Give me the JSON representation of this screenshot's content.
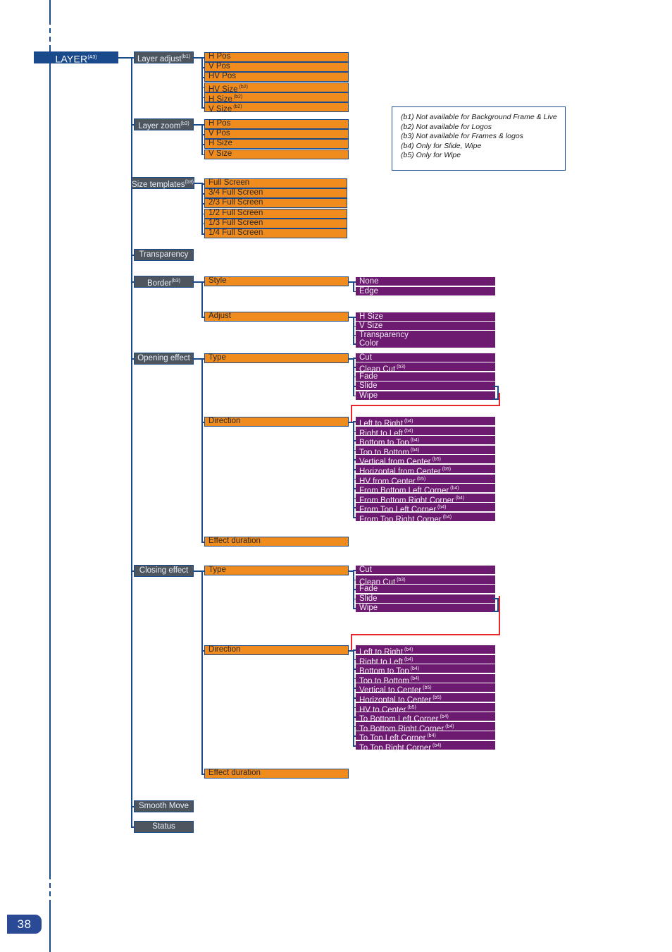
{
  "page": {
    "number": "38",
    "title": "LAYER",
    "title_sup": "(A3)"
  },
  "legend": {
    "lines": [
      "(b1) Not available for Background Frame & Live",
      "(b2) Not available for Logos",
      "(b3) Not available for Frames & logos",
      "(b4) Only for Slide, Wipe",
      "(b5) Only for Wipe"
    ]
  },
  "colors": {
    "navy": "#1b4a8c",
    "grey": "#4d565f",
    "orange": "#f08b1d",
    "purple": "#6d1a71",
    "red": "#e8272c",
    "page_tab": "#2a4a96"
  },
  "menu": {
    "layer_adjust": {
      "label": "Layer adjust",
      "sup": "(b1)"
    },
    "layer_adjust_items": [
      {
        "label": "H Pos",
        "sup": ""
      },
      {
        "label": "V Pos",
        "sup": ""
      },
      {
        "label": "HV Pos",
        "sup": ""
      },
      {
        "label": "HV Size",
        "sup": "(b2)"
      },
      {
        "label": "H Size",
        "sup": "(b2)"
      },
      {
        "label": "V Size",
        "sup": "(b2)"
      }
    ],
    "layer_zoom": {
      "label": "Layer zoom",
      "sup": "(b3)"
    },
    "layer_zoom_items": [
      {
        "label": "H Pos",
        "sup": ""
      },
      {
        "label": "V Pos",
        "sup": ""
      },
      {
        "label": "H Size",
        "sup": ""
      },
      {
        "label": "V Size",
        "sup": ""
      }
    ],
    "size_templates": {
      "label": "Size templates",
      "sup": "(b3)"
    },
    "size_templates_items": [
      {
        "label": "Full Screen",
        "sup": ""
      },
      {
        "label": "3/4 Full Screen",
        "sup": ""
      },
      {
        "label": "2/3 Full Screen",
        "sup": ""
      },
      {
        "label": "1/2 Full Screen",
        "sup": ""
      },
      {
        "label": "1/3 Full Screen",
        "sup": ""
      },
      {
        "label": "1/4 Full Screen",
        "sup": ""
      }
    ],
    "transparency": {
      "label": "Transparency",
      "sup": ""
    },
    "border": {
      "label": "Border",
      "sup": "(b3)"
    },
    "border_style": {
      "label": "Style",
      "sup": ""
    },
    "border_style_items": [
      {
        "label": "None",
        "sup": ""
      },
      {
        "label": "Edge",
        "sup": ""
      }
    ],
    "border_adjust": {
      "label": "Adjust",
      "sup": ""
    },
    "border_adjust_items": [
      {
        "label": "H Size",
        "sup": ""
      },
      {
        "label": "V Size",
        "sup": ""
      },
      {
        "label": "Transparency",
        "sup": ""
      },
      {
        "label": "Color",
        "sup": ""
      }
    ],
    "opening_effect": {
      "label": "Opening effect",
      "sup": ""
    },
    "opening_type": {
      "label": "Type",
      "sup": ""
    },
    "opening_type_items": [
      {
        "label": "Cut",
        "sup": ""
      },
      {
        "label": "Clean Cut",
        "sup": "(b3)"
      },
      {
        "label": "Fade",
        "sup": ""
      },
      {
        "label": "Slide",
        "sup": ""
      },
      {
        "label": "Wipe",
        "sup": ""
      }
    ],
    "opening_direction": {
      "label": "Direction",
      "sup": ""
    },
    "opening_direction_items": [
      {
        "label": "Left to Right",
        "sup": "(b4)"
      },
      {
        "label": "Right to Left",
        "sup": "(b4)"
      },
      {
        "label": "Bottom to Top",
        "sup": "(b4)"
      },
      {
        "label": "Top to Bottom",
        "sup": "(b4)"
      },
      {
        "label": "Vertical from Center",
        "sup": "(b5)"
      },
      {
        "label": "Horizontal from Center",
        "sup": "(b5)"
      },
      {
        "label": "HV from Center",
        "sup": "(b5)"
      },
      {
        "label": "From Bottom Left Corner",
        "sup": "(b4)"
      },
      {
        "label": "From Bottom Right Corner",
        "sup": "(b4)"
      },
      {
        "label": "From Top Left Corner",
        "sup": "(b4)"
      },
      {
        "label": "From Top Right Corner",
        "sup": "(b4)"
      }
    ],
    "opening_effect_duration": {
      "label": "Effect duration",
      "sup": ""
    },
    "closing_effect": {
      "label": "Closing effect",
      "sup": ""
    },
    "closing_type": {
      "label": "Type",
      "sup": ""
    },
    "closing_type_items": [
      {
        "label": "Cut",
        "sup": ""
      },
      {
        "label": "Clean Cut",
        "sup": "(b3)"
      },
      {
        "label": "Fade",
        "sup": ""
      },
      {
        "label": "Slide",
        "sup": ""
      },
      {
        "label": "Wipe",
        "sup": ""
      }
    ],
    "closing_direction": {
      "label": "Direction",
      "sup": ""
    },
    "closing_direction_items": [
      {
        "label": "Left to Right",
        "sup": "(b4)"
      },
      {
        "label": "Right to Left",
        "sup": "(b4)"
      },
      {
        "label": "Bottom to Top",
        "sup": "(b4)"
      },
      {
        "label": "Top to Bottom",
        "sup": "(b4)"
      },
      {
        "label": "Vertical to Center",
        "sup": "(b5)"
      },
      {
        "label": "Horizontal to Center",
        "sup": "(b5)"
      },
      {
        "label": "HV to Center",
        "sup": "(b5)"
      },
      {
        "label": "To Bottom Left Corner",
        "sup": "(b4)"
      },
      {
        "label": "To Bottom Right Corner",
        "sup": "(b4)"
      },
      {
        "label": "To Top Left Corner",
        "sup": "(b4)"
      },
      {
        "label": "To Top Right Corner",
        "sup": "(b4)"
      }
    ],
    "closing_effect_duration": {
      "label": "Effect duration",
      "sup": ""
    },
    "smooth_move": {
      "label": "Smooth Move",
      "sup": ""
    },
    "status": {
      "label": "Status",
      "sup": ""
    }
  }
}
